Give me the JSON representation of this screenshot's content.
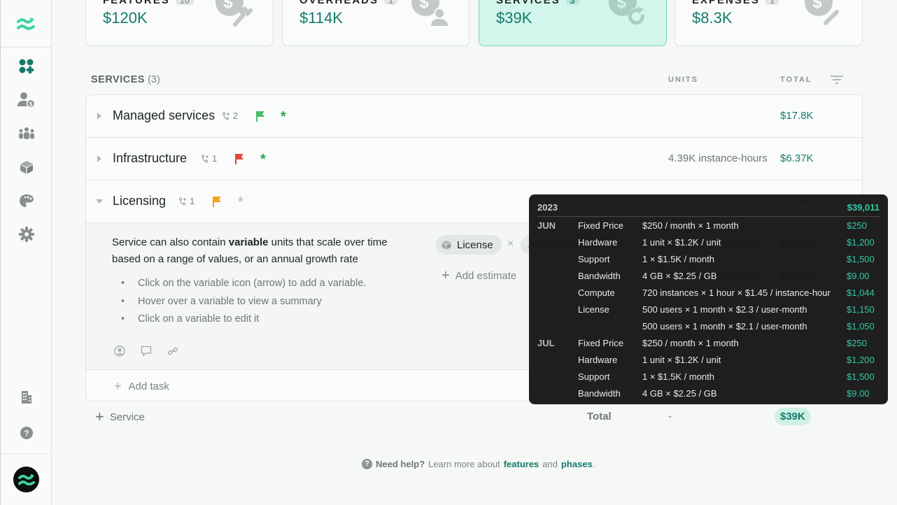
{
  "sidebar": {
    "items": [
      {
        "name": "dashboard",
        "icon": "apps-add-icon",
        "active": true
      },
      {
        "name": "customers",
        "icon": "user-dollar-icon",
        "active": false
      },
      {
        "name": "team",
        "icon": "people-group-icon",
        "active": false
      },
      {
        "name": "products",
        "icon": "cube-icon",
        "active": false
      },
      {
        "name": "design",
        "icon": "palette-icon",
        "active": false
      },
      {
        "name": "settings",
        "icon": "gear-icon",
        "active": false
      }
    ],
    "bottom_items": [
      {
        "name": "company",
        "icon": "building-icon"
      },
      {
        "name": "help",
        "icon": "question-icon"
      }
    ]
  },
  "cards": [
    {
      "label": "FEATURES",
      "count": "10",
      "value": "$120K",
      "icon": "dollar-wrench-icon",
      "active": false
    },
    {
      "label": "OVERHEADS",
      "count": "1",
      "value": "$114K",
      "icon": "dollar-user-icon",
      "active": false
    },
    {
      "label": "SERVICES",
      "count": "3",
      "value": "$39K",
      "icon": "dollar-refresh-icon",
      "active": true
    },
    {
      "label": "EXPENSES",
      "count": "1",
      "value": "$8.3K",
      "icon": "dollar-pencil-icon",
      "active": false
    }
  ],
  "section": {
    "title": "SERVICES",
    "count": "(3)",
    "col_units": "UNITS",
    "col_total": "TOTAL"
  },
  "services": [
    {
      "name": "Managed services",
      "deps": "2",
      "flag_color": "#4cbb6c",
      "star_color": "#2ea454",
      "units": "",
      "total": "$17.8K",
      "expanded": false
    },
    {
      "name": "Infrastructure",
      "deps": "1",
      "flag_color": "#e0483a",
      "star_color": "#2ea454",
      "units": "4.39K instance-hours",
      "total": "$6.37K",
      "expanded": false
    },
    {
      "name": "Licensing",
      "deps": "1",
      "flag_color": "#f0a21c",
      "star_color": "#c2c6c5",
      "units": "6.81K user-months",
      "total": "$14.9K",
      "expanded": true
    }
  ],
  "licensing_detail": {
    "desc_pre": "Service can also contain ",
    "desc_bold": "variable",
    "desc_post": " units that scale over time based on a range of values, or an annual growth rate",
    "bullets": [
      "Click on the variable icon (arrow) to add a variable.",
      "Hover over a variable to view a summary",
      "Click on a variable to edit it"
    ],
    "chips": [
      {
        "label": "License",
        "icon": "cube-icon"
      },
      {
        "label": "Subscribers",
        "icon": "arrow-trend-icon"
      }
    ],
    "add_estimate": "Add estimate",
    "estimate_rows": [
      {
        "units": "6.81K user-months",
        "total": "$14.9K"
      },
      {
        "units": "6.81K user-months",
        "total": "$14.9K"
      }
    ],
    "add_task": "Add task"
  },
  "footer": {
    "add_service": "Service",
    "total_label": "Total",
    "total_units": "-",
    "total_value": "$39K"
  },
  "help": {
    "lead": "Need help?",
    "text": "Learn more about",
    "link1": "features",
    "and": "and",
    "link2": "phases",
    "end": "."
  },
  "tooltip": {
    "year": "2023",
    "sum": "$39,011",
    "rows": [
      {
        "month": "JUN",
        "name": "Fixed Price",
        "formula": "$250 / month × 1 month",
        "amount": "$250"
      },
      {
        "month": "",
        "name": "Hardware",
        "formula": "1 unit × $1.2K / unit",
        "amount": "$1,200"
      },
      {
        "month": "",
        "name": "Support",
        "formula": "1 × $1.5K / month",
        "amount": "$1,500"
      },
      {
        "month": "",
        "name": "Bandwidth",
        "formula": "4 GB × $2.25 / GB",
        "amount": "$9.00"
      },
      {
        "month": "",
        "name": "Compute",
        "formula": "720 instances × 1 hour × $1.45 / instance-hour",
        "amount": "$1,044"
      },
      {
        "month": "",
        "name": "License",
        "formula": "500 users × 1 month × $2.3 / user-month",
        "amount": "$1,150"
      },
      {
        "month": "",
        "name": "",
        "formula": "500 users × 1 month × $2.1 / user-month",
        "amount": "$1,050"
      },
      {
        "month": "JUL",
        "name": "Fixed Price",
        "formula": "$250 / month × 1 month",
        "amount": "$250"
      },
      {
        "month": "",
        "name": "Hardware",
        "formula": "1 unit × $1.2K / unit",
        "amount": "$1,200"
      },
      {
        "month": "",
        "name": "Support",
        "formula": "1 × $1.5K / month",
        "amount": "$1,500"
      },
      {
        "month": "",
        "name": "Bandwidth",
        "formula": "4 GB × $2.25 / GB",
        "amount": "$9.00"
      }
    ]
  },
  "colors": {
    "accent": "#157a6a",
    "accent_bright": "#2fc7a3",
    "active_card_bg": "#d2f6ec"
  }
}
